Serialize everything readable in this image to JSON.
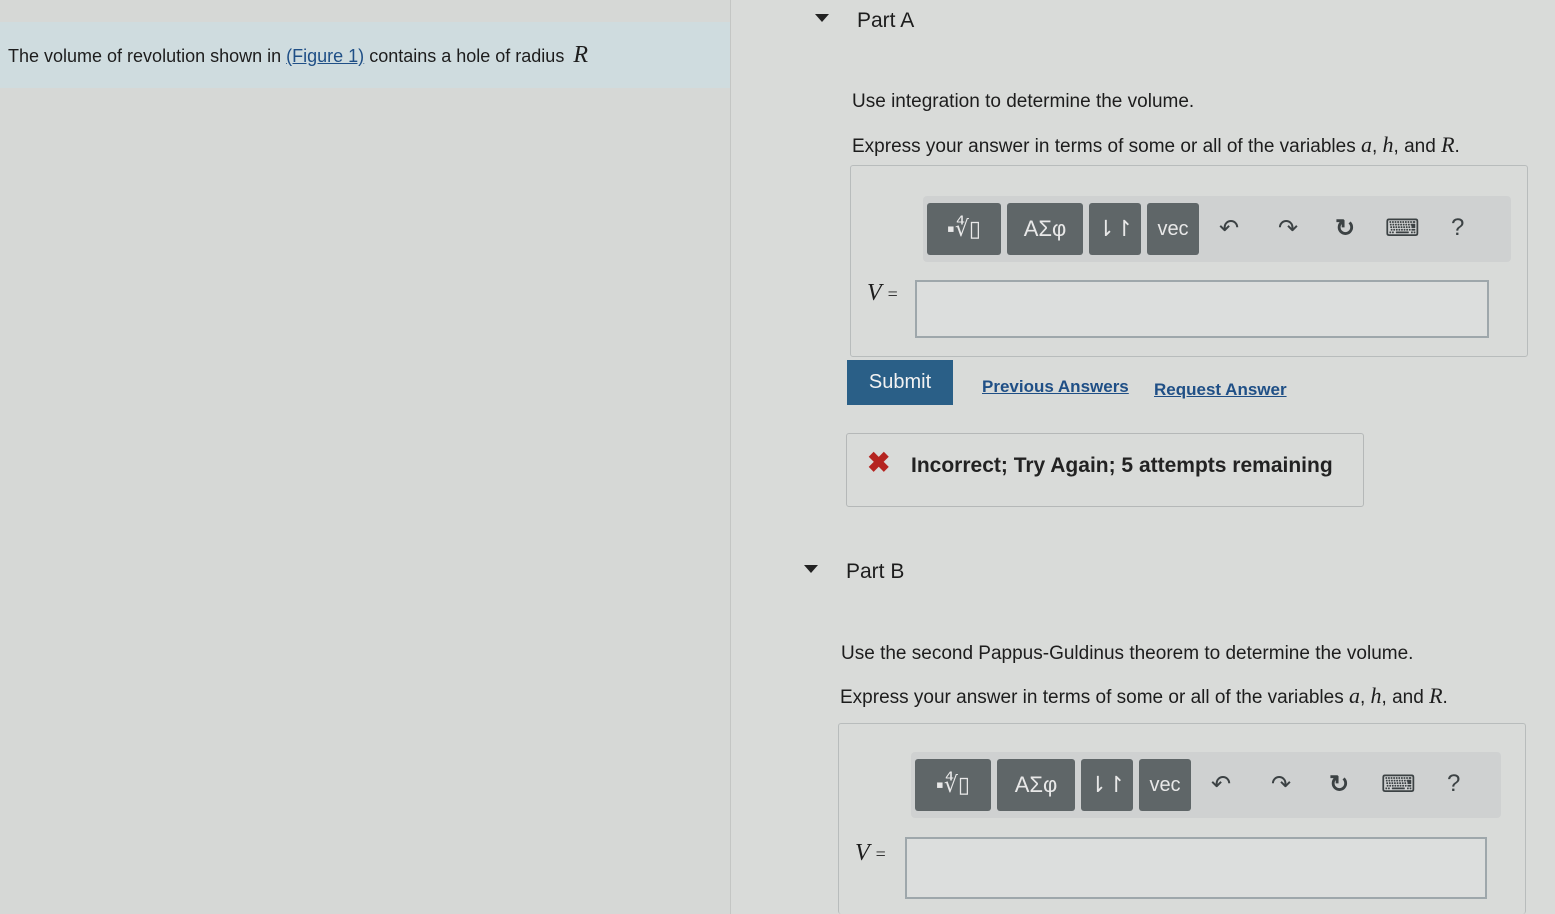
{
  "problem": {
    "intro_before": "The volume of revolution shown in ",
    "figure_link": "(Figure 1)",
    "intro_after": " contains a hole of radius ",
    "radius_var": "R"
  },
  "part_a": {
    "title": "Part A",
    "instruction": "Use integration to determine the volume.",
    "express_prefix": "Express your answer in terms of some or all of the variables ",
    "var_a": "a",
    "var_h": "h",
    "and_text": "and",
    "var_R": "R",
    "equation_var": "V",
    "equation_eq": "=",
    "input_value": "",
    "submit_label": "Submit",
    "prev_answers_label": "Previous Answers",
    "request_answer_label": "Request Answer",
    "feedback_text": "Incorrect; Try Again; 5 attempts remaining"
  },
  "part_b": {
    "title": "Part B",
    "instruction": "Use the second Pappus-Guldinus theorem to determine the volume.",
    "express_prefix": "Express your answer in terms of some or all of the variables ",
    "var_a": "a",
    "var_h": "h",
    "and_text": "and",
    "var_R": "R",
    "equation_var": "V",
    "equation_eq": "=",
    "input_value": ""
  },
  "toolbar": {
    "templates_label": "▪∜▯",
    "greek_label": "ΑΣφ",
    "arrows_label": "⇂↾",
    "vec_label": "vec",
    "undo_icon": "↶",
    "redo_icon": "↷",
    "reset_icon": "↻",
    "keyboard_icon": "⌨",
    "help_label": "?"
  },
  "colors": {
    "submit_bg": "#2a5f87",
    "error_x": "#b52420",
    "link": "#1f4f86"
  }
}
